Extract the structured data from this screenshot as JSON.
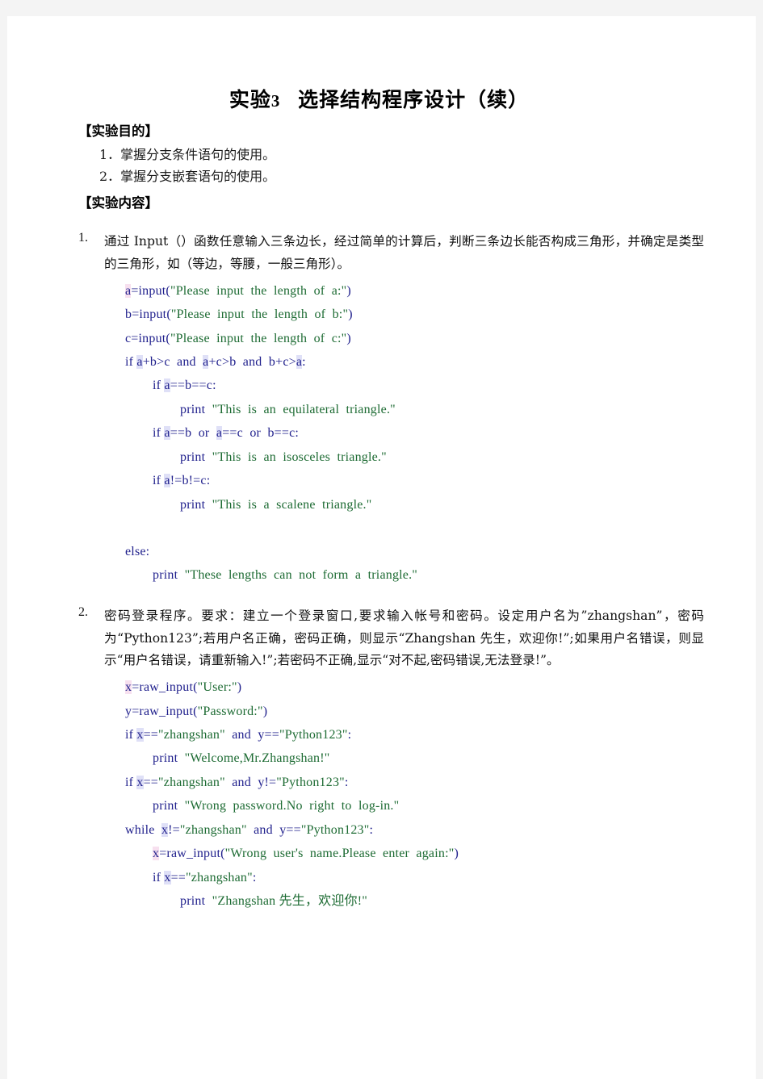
{
  "document": {
    "title_main": "实验",
    "title_number": "3",
    "title_rest": "选择结构程序设计（续）",
    "section_purpose": "【实验目的】",
    "section_content": "【实验内容】",
    "objectives": [
      "1．掌握分支条件语句的使用。",
      "2．掌握分支嵌套语句的使用。"
    ],
    "problems": [
      {
        "marker": "1.",
        "description": "通过 Input（）函数任意输入三条边长，经过简单的计算后，判断三条边长能否构成三角形，并确定是类型的三角形，如（等边，等腰，一般三角形）。",
        "code": [
          {
            "indent": 1,
            "tokens": [
              {
                "t": "a",
                "c": "idp"
              },
              {
                "t": "=input(",
                "c": "kw"
              },
              {
                "t": "\"Please  input  the  length  of  a:\"",
                "c": "str"
              },
              {
                "t": ")",
                "c": "kw"
              }
            ]
          },
          {
            "indent": 1,
            "tokens": [
              {
                "t": "b=input(",
                "c": "kw"
              },
              {
                "t": "\"Please  input  the  length  of  b:\"",
                "c": "str"
              },
              {
                "t": ")",
                "c": "kw"
              }
            ]
          },
          {
            "indent": 1,
            "tokens": [
              {
                "t": "c=input(",
                "c": "kw"
              },
              {
                "t": "\"Please  input  the  length  of  c:\"",
                "c": "str"
              },
              {
                "t": ")",
                "c": "kw"
              }
            ]
          },
          {
            "indent": 1,
            "tokens": [
              {
                "t": "if ",
                "c": "kw"
              },
              {
                "t": "a",
                "c": "id"
              },
              {
                "t": "+b>c  and  ",
                "c": "kw"
              },
              {
                "t": "a",
                "c": "id"
              },
              {
                "t": "+c>b  and  b+c>",
                "c": "kw"
              },
              {
                "t": "a",
                "c": "id"
              },
              {
                "t": ":",
                "c": "kw"
              }
            ]
          },
          {
            "indent": 2,
            "tokens": [
              {
                "t": "if ",
                "c": "kw"
              },
              {
                "t": "a",
                "c": "id"
              },
              {
                "t": "==b==c:",
                "c": "kw"
              }
            ]
          },
          {
            "indent": 3,
            "tokens": [
              {
                "t": "print  ",
                "c": "kw"
              },
              {
                "t": "\"This  is  an  equilateral  triangle.\"",
                "c": "str"
              }
            ]
          },
          {
            "indent": 2,
            "tokens": [
              {
                "t": "if ",
                "c": "kw"
              },
              {
                "t": "a",
                "c": "id"
              },
              {
                "t": "==b  or  ",
                "c": "kw"
              },
              {
                "t": "a",
                "c": "id"
              },
              {
                "t": "==c  or  b==c:",
                "c": "kw"
              }
            ]
          },
          {
            "indent": 3,
            "tokens": [
              {
                "t": "print  ",
                "c": "kw"
              },
              {
                "t": "\"This  is  an  isosceles  triangle.\"",
                "c": "str"
              }
            ]
          },
          {
            "indent": 2,
            "tokens": [
              {
                "t": "if ",
                "c": "kw"
              },
              {
                "t": "a",
                "c": "id"
              },
              {
                "t": "!=b!=c:",
                "c": "kw"
              }
            ]
          },
          {
            "indent": 3,
            "tokens": [
              {
                "t": "print  ",
                "c": "kw"
              },
              {
                "t": "\"This  is  a  scalene  triangle.\"",
                "c": "str"
              }
            ]
          },
          {
            "indent": 1,
            "blank": true,
            "tokens": []
          },
          {
            "indent": 1,
            "tokens": [
              {
                "t": "else:",
                "c": "kw"
              }
            ]
          },
          {
            "indent": 2,
            "tokens": [
              {
                "t": "print  ",
                "c": "kw"
              },
              {
                "t": "\"These  lengths  can  not  form  a  triangle.\"",
                "c": "str"
              }
            ]
          }
        ]
      },
      {
        "marker": "2.",
        "description": "密码登录程序。要求：建立一个登录窗口,要求输入帐号和密码。设定用户名为”zhangshan”，密码为“Python123”;若用户名正确，密码正确，则显示“Zhangshan 先生，欢迎你!”;如果用户名错误，则显示“用户名错误，请重新输入!”;若密码不正确,显示“对不起,密码错误,无法登录!”。",
        "code": [
          {
            "indent": 1,
            "tokens": [
              {
                "t": "x",
                "c": "idp"
              },
              {
                "t": "=raw_input(",
                "c": "kw"
              },
              {
                "t": "\"User:\"",
                "c": "str"
              },
              {
                "t": ")",
                "c": "kw"
              }
            ]
          },
          {
            "indent": 1,
            "tokens": [
              {
                "t": "y=raw_input(",
                "c": "kw"
              },
              {
                "t": "\"Password:\"",
                "c": "str"
              },
              {
                "t": ")",
                "c": "kw"
              }
            ]
          },
          {
            "indent": 1,
            "tokens": [
              {
                "t": "if ",
                "c": "kw"
              },
              {
                "t": "x",
                "c": "id"
              },
              {
                "t": "==",
                "c": "kw"
              },
              {
                "t": "\"zhangshan\"",
                "c": "str"
              },
              {
                "t": "  and  y==",
                "c": "kw"
              },
              {
                "t": "\"Python123\"",
                "c": "str"
              },
              {
                "t": ":",
                "c": "kw"
              }
            ]
          },
          {
            "indent": 2,
            "tokens": [
              {
                "t": "print  ",
                "c": "kw"
              },
              {
                "t": "\"Welcome,Mr.Zhangshan!\"",
                "c": "str"
              }
            ]
          },
          {
            "indent": 1,
            "tokens": [
              {
                "t": "if ",
                "c": "kw"
              },
              {
                "t": "x",
                "c": "id"
              },
              {
                "t": "==",
                "c": "kw"
              },
              {
                "t": "\"zhangshan\"",
                "c": "str"
              },
              {
                "t": "  and  y!=",
                "c": "kw"
              },
              {
                "t": "\"Python123\"",
                "c": "str"
              },
              {
                "t": ":",
                "c": "kw"
              }
            ]
          },
          {
            "indent": 2,
            "tokens": [
              {
                "t": "print  ",
                "c": "kw"
              },
              {
                "t": "\"Wrong  password.No  right  to  log-in.\"",
                "c": "str"
              }
            ]
          },
          {
            "indent": 1,
            "tokens": [
              {
                "t": "while  ",
                "c": "kw"
              },
              {
                "t": "x",
                "c": "id"
              },
              {
                "t": "!=",
                "c": "kw"
              },
              {
                "t": "\"zhangshan\"",
                "c": "str"
              },
              {
                "t": "  and  y==",
                "c": "kw"
              },
              {
                "t": "\"Python123\"",
                "c": "str"
              },
              {
                "t": ":",
                "c": "kw"
              }
            ]
          },
          {
            "indent": 2,
            "tokens": [
              {
                "t": "x",
                "c": "idp"
              },
              {
                "t": "=raw_input(",
                "c": "kw"
              },
              {
                "t": "\"Wrong  user's  name.Please  enter  again:\"",
                "c": "str"
              },
              {
                "t": ")",
                "c": "kw"
              }
            ]
          },
          {
            "indent": 2,
            "tokens": [
              {
                "t": "if ",
                "c": "kw"
              },
              {
                "t": "x",
                "c": "id"
              },
              {
                "t": "==",
                "c": "kw"
              },
              {
                "t": "\"zhangshan\"",
                "c": "str"
              },
              {
                "t": ":",
                "c": "kw"
              }
            ]
          },
          {
            "indent": 3,
            "tokens": [
              {
                "t": "print  ",
                "c": "kw"
              },
              {
                "t": "\"Zhangshan 先生，欢迎你!\"",
                "c": "str"
              }
            ]
          }
        ]
      }
    ]
  },
  "colors": {
    "page_background": "#ffffff",
    "canvas_background": "#f4f4f4",
    "code_keyword": "#1f1f8c",
    "code_string": "#1d6b33",
    "highlight_blue": "#dfe0f7",
    "highlight_pink": "#f7e0ef",
    "body_text": "#111111"
  }
}
